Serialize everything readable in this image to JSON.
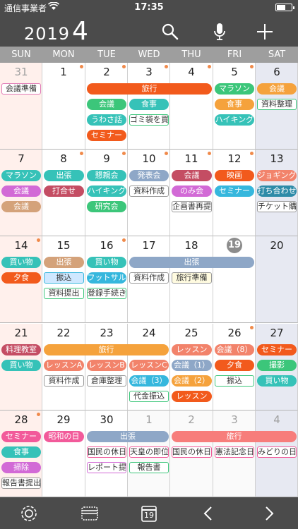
{
  "status": {
    "carrier": "通信事業者",
    "time": "17:35"
  },
  "header": {
    "year": "2019",
    "month": "4"
  },
  "weekdays": [
    "SUN",
    "MON",
    "TUE",
    "WED",
    "THU",
    "FRI",
    "SAT"
  ],
  "colors": {
    "orange": "#f5a23c",
    "green": "#3cc67a",
    "teal": "#36c2b8",
    "red": "#f25a3c",
    "magenta": "#d26ad6",
    "tan": "#d4a27a",
    "pink": "#f37b93",
    "blue": "#8ea7c7",
    "maroon": "#c44d63",
    "cyan": "#36b7dd",
    "salmon": "#f2836b",
    "coral": "#f77d7b"
  },
  "cells": [
    {
      "day": "31",
      "other": true
    },
    {
      "day": "1",
      "dot": true
    },
    {
      "day": "2",
      "dot": true
    },
    {
      "day": "3",
      "dot": true
    },
    {
      "day": "4",
      "dot": true
    },
    {
      "day": "5",
      "dot": true
    },
    {
      "day": "6"
    },
    {
      "day": "7"
    },
    {
      "day": "8",
      "dot": true
    },
    {
      "day": "9",
      "dot": true
    },
    {
      "day": "10",
      "dot": true
    },
    {
      "day": "11",
      "dot": true
    },
    {
      "day": "12",
      "dot": true
    },
    {
      "day": "13"
    },
    {
      "day": "14",
      "dot": true
    },
    {
      "day": "15"
    },
    {
      "day": "16",
      "dot": true
    },
    {
      "day": "17"
    },
    {
      "day": "18"
    },
    {
      "day": "19",
      "today": true
    },
    {
      "day": "20"
    },
    {
      "day": "21"
    },
    {
      "day": "22"
    },
    {
      "day": "23"
    },
    {
      "day": "24"
    },
    {
      "day": "25"
    },
    {
      "day": "26",
      "dot": true
    },
    {
      "day": "27"
    },
    {
      "day": "28",
      "dot": true
    },
    {
      "day": "29"
    },
    {
      "day": "30"
    },
    {
      "day": "1",
      "other": true
    },
    {
      "day": "2",
      "other": true
    },
    {
      "day": "3",
      "other": true
    },
    {
      "day": "4",
      "other": true
    }
  ],
  "events": [
    {
      "w": 0,
      "c": 0,
      "s": 1,
      "slot": 0,
      "label": "会議準備",
      "style": "box",
      "color": "#e07ab6"
    },
    {
      "w": 0,
      "c": 2,
      "s": 3,
      "slot": 0,
      "label": "旅行",
      "color": "#f25a1c"
    },
    {
      "w": 0,
      "c": 5,
      "s": 1,
      "slot": 0,
      "label": "マラソン",
      "color": "#3cc67a"
    },
    {
      "w": 0,
      "c": 6,
      "s": 1,
      "slot": 0,
      "label": "会議",
      "color": "#f5a23c"
    },
    {
      "w": 0,
      "c": 2,
      "s": 1,
      "slot": 1,
      "label": "会議",
      "color": "#3cc67a"
    },
    {
      "w": 0,
      "c": 3,
      "s": 1,
      "slot": 1,
      "label": "食事",
      "color": "#36c2b8"
    },
    {
      "w": 0,
      "c": 5,
      "s": 1,
      "slot": 1,
      "label": "食事",
      "color": "#f5a23c"
    },
    {
      "w": 0,
      "c": 6,
      "s": 1,
      "slot": 1,
      "label": "資料整理",
      "style": "box",
      "color": "#3cc67a"
    },
    {
      "w": 0,
      "c": 2,
      "s": 1,
      "slot": 2,
      "label": "うわさ話",
      "color": "#36c2b8"
    },
    {
      "w": 0,
      "c": 3,
      "s": 1,
      "slot": 2,
      "label": "ゴミ袋を買",
      "style": "box",
      "color": "#3cc67a"
    },
    {
      "w": 0,
      "c": 5,
      "s": 1,
      "slot": 2,
      "label": "ハイキング",
      "color": "#36c2b8"
    },
    {
      "w": 0,
      "c": 2,
      "s": 1,
      "slot": 3,
      "label": "セミナー",
      "color": "#f25a1c"
    },
    {
      "w": 1,
      "c": 0,
      "s": 1,
      "slot": 0,
      "label": "マラソン",
      "color": "#36c2b8"
    },
    {
      "w": 1,
      "c": 1,
      "s": 1,
      "slot": 0,
      "label": "出張",
      "color": "#36c2b8"
    },
    {
      "w": 1,
      "c": 2,
      "s": 1,
      "slot": 0,
      "label": "懇親会",
      "color": "#36c2b8"
    },
    {
      "w": 1,
      "c": 3,
      "s": 1,
      "slot": 0,
      "label": "発表会",
      "color": "#8ea7c7"
    },
    {
      "w": 1,
      "c": 4,
      "s": 1,
      "slot": 0,
      "label": "会議",
      "color": "#c44d63"
    },
    {
      "w": 1,
      "c": 5,
      "s": 1,
      "slot": 0,
      "label": "映画",
      "color": "#f25a1c"
    },
    {
      "w": 1,
      "c": 6,
      "s": 1,
      "slot": 0,
      "label": "ジョギング",
      "color": "#f2836b"
    },
    {
      "w": 1,
      "c": 0,
      "s": 1,
      "slot": 1,
      "label": "会議",
      "color": "#d26ad6"
    },
    {
      "w": 1,
      "c": 1,
      "s": 1,
      "slot": 1,
      "label": "打合せ",
      "color": "#c44d63"
    },
    {
      "w": 1,
      "c": 2,
      "s": 1,
      "slot": 1,
      "label": "ハイキング",
      "color": "#36c2b8"
    },
    {
      "w": 1,
      "c": 3,
      "s": 1,
      "slot": 1,
      "label": "資料作成",
      "style": "box",
      "color": "#999999"
    },
    {
      "w": 1,
      "c": 4,
      "s": 1,
      "slot": 1,
      "label": "のみ会",
      "color": "#d26ad6"
    },
    {
      "w": 1,
      "c": 5,
      "s": 1,
      "slot": 1,
      "label": "セミナー",
      "color": "#36b7dd"
    },
    {
      "w": 1,
      "c": 6,
      "s": 1,
      "slot": 1,
      "label": "打ち合わせ",
      "color": "#2e8ba8"
    },
    {
      "w": 1,
      "c": 0,
      "s": 1,
      "slot": 2,
      "label": "会議",
      "color": "#d4a27a"
    },
    {
      "w": 1,
      "c": 2,
      "s": 1,
      "slot": 2,
      "label": "研究会",
      "color": "#3cc67a"
    },
    {
      "w": 1,
      "c": 4,
      "s": 1,
      "slot": 2,
      "label": "企画書再提",
      "style": "box",
      "color": "#999999"
    },
    {
      "w": 1,
      "c": 6,
      "s": 1,
      "slot": 2,
      "label": "チケット購",
      "style": "box",
      "color": "#999999"
    },
    {
      "w": 2,
      "c": 0,
      "s": 1,
      "slot": 0,
      "label": "買い物",
      "color": "#36c2b8"
    },
    {
      "w": 2,
      "c": 1,
      "s": 1,
      "slot": 0,
      "label": "出張",
      "color": "#d4a27a"
    },
    {
      "w": 2,
      "c": 2,
      "s": 1,
      "slot": 0,
      "label": "買い物",
      "color": "#36c2b8"
    },
    {
      "w": 2,
      "c": 3,
      "s": 3,
      "slot": 0,
      "label": "出張",
      "color": "#8ea7c7"
    },
    {
      "w": 2,
      "c": 0,
      "s": 1,
      "slot": 1,
      "label": "夕食",
      "color": "#f25a1c"
    },
    {
      "w": 2,
      "c": 1,
      "s": 1,
      "slot": 1,
      "label": "振込",
      "style": "box",
      "color": "#36b7dd",
      "fill": "#cfe8ff"
    },
    {
      "w": 2,
      "c": 2,
      "s": 1,
      "slot": 1,
      "label": "フットサル",
      "color": "#36b7dd"
    },
    {
      "w": 2,
      "c": 3,
      "s": 1,
      "slot": 1,
      "label": "資料作成",
      "style": "box",
      "color": "#999999"
    },
    {
      "w": 2,
      "c": 4,
      "s": 1,
      "slot": 1,
      "label": "旅行準備",
      "style": "box",
      "color": "#999999",
      "fill": "#fffbe0"
    },
    {
      "w": 2,
      "c": 1,
      "s": 1,
      "slot": 2,
      "label": "資料提出",
      "style": "box",
      "color": "#3cc67a"
    },
    {
      "w": 2,
      "c": 2,
      "s": 1,
      "slot": 2,
      "label": "登録手続き",
      "style": "box",
      "color": "#3cc67a"
    },
    {
      "w": 3,
      "c": 0,
      "s": 1,
      "slot": 0,
      "label": "料理教室",
      "color": "#c44d63"
    },
    {
      "w": 3,
      "c": 1,
      "s": 3,
      "slot": 0,
      "label": "旅行",
      "color": "#f5a23c"
    },
    {
      "w": 3,
      "c": 4,
      "s": 1,
      "slot": 0,
      "label": "レッスン",
      "color": "#f2836b"
    },
    {
      "w": 3,
      "c": 5,
      "s": 1,
      "slot": 0,
      "label": "会議（8）",
      "color": "#f2836b"
    },
    {
      "w": 3,
      "c": 6,
      "s": 1,
      "slot": 0,
      "label": "セミナー",
      "color": "#f25a1c"
    },
    {
      "w": 3,
      "c": 0,
      "s": 1,
      "slot": 1,
      "label": "買い物",
      "color": "#36c2b8"
    },
    {
      "w": 3,
      "c": 1,
      "s": 1,
      "slot": 1,
      "label": "レッスンA",
      "color": "#f2836b"
    },
    {
      "w": 3,
      "c": 2,
      "s": 1,
      "slot": 1,
      "label": "レッスンB",
      "color": "#f2836b"
    },
    {
      "w": 3,
      "c": 3,
      "s": 1,
      "slot": 1,
      "label": "レッスンC",
      "color": "#f2836b"
    },
    {
      "w": 3,
      "c": 4,
      "s": 1,
      "slot": 1,
      "label": "会議（1）",
      "color": "#8ea7c7"
    },
    {
      "w": 3,
      "c": 5,
      "s": 1,
      "slot": 1,
      "label": "夕食",
      "color": "#f25a1c"
    },
    {
      "w": 3,
      "c": 6,
      "s": 1,
      "slot": 1,
      "label": "撮影",
      "color": "#3cc67a"
    },
    {
      "w": 3,
      "c": 1,
      "s": 1,
      "slot": 2,
      "label": "資料作成",
      "style": "box",
      "color": "#999999"
    },
    {
      "w": 3,
      "c": 2,
      "s": 1,
      "slot": 2,
      "label": "倉庫整理",
      "style": "box",
      "color": "#999999"
    },
    {
      "w": 3,
      "c": 3,
      "s": 1,
      "slot": 2,
      "label": "会議（3）",
      "color": "#36b7dd"
    },
    {
      "w": 3,
      "c": 4,
      "s": 1,
      "slot": 2,
      "label": "会議（2）",
      "color": "#f5a23c"
    },
    {
      "w": 3,
      "c": 5,
      "s": 1,
      "slot": 2,
      "label": "振込",
      "style": "box",
      "color": "#3cc67a"
    },
    {
      "w": 3,
      "c": 6,
      "s": 1,
      "slot": 2,
      "label": "買い物",
      "color": "#36c2b8"
    },
    {
      "w": 3,
      "c": 3,
      "s": 1,
      "slot": 3,
      "label": "代金振込",
      "style": "box",
      "color": "#3cc67a"
    },
    {
      "w": 3,
      "c": 4,
      "s": 1,
      "slot": 3,
      "label": "レッスン",
      "color": "#f25a1c"
    },
    {
      "w": 4,
      "c": 0,
      "s": 1,
      "slot": 0,
      "label": "セミナー",
      "color": "#f25a9a"
    },
    {
      "w": 4,
      "c": 1,
      "s": 1,
      "slot": 0,
      "label": "昭和の日",
      "color": "#f25a9a"
    },
    {
      "w": 4,
      "c": 2,
      "s": 2,
      "slot": 0,
      "label": "出張",
      "color": "#8ea7c7"
    },
    {
      "w": 4,
      "c": 4,
      "s": 3,
      "slot": 0,
      "label": "旅行",
      "color": "#f77d7b"
    },
    {
      "w": 4,
      "c": 0,
      "s": 1,
      "slot": 1,
      "label": "食事",
      "color": "#36c2b8"
    },
    {
      "w": 4,
      "c": 2,
      "s": 1,
      "slot": 1,
      "label": "国民の休日",
      "style": "box",
      "color": "#f25a9a"
    },
    {
      "w": 4,
      "c": 3,
      "s": 1,
      "slot": 1,
      "label": "天皇の即位",
      "style": "box",
      "color": "#f25a9a"
    },
    {
      "w": 4,
      "c": 4,
      "s": 1,
      "slot": 1,
      "label": "国民の休日",
      "style": "box",
      "color": "#f25a9a"
    },
    {
      "w": 4,
      "c": 5,
      "s": 1,
      "slot": 1,
      "label": "憲法記念日",
      "style": "box",
      "color": "#f25a9a"
    },
    {
      "w": 4,
      "c": 6,
      "s": 1,
      "slot": 1,
      "label": "みどりの日",
      "style": "box",
      "color": "#f25a9a"
    },
    {
      "w": 4,
      "c": 0,
      "s": 1,
      "slot": 2,
      "label": "掃除",
      "color": "#d26ad6"
    },
    {
      "w": 4,
      "c": 2,
      "s": 1,
      "slot": 2,
      "label": "レポート提",
      "style": "box",
      "color": "#d26ad6"
    },
    {
      "w": 4,
      "c": 3,
      "s": 1,
      "slot": 2,
      "label": "報告書",
      "style": "box",
      "color": "#3cc67a"
    },
    {
      "w": 4,
      "c": 0,
      "s": 1,
      "slot": 3,
      "label": "報告書提出",
      "style": "box",
      "color": "#999999"
    }
  ],
  "toolbar": {
    "today_label": "19"
  }
}
